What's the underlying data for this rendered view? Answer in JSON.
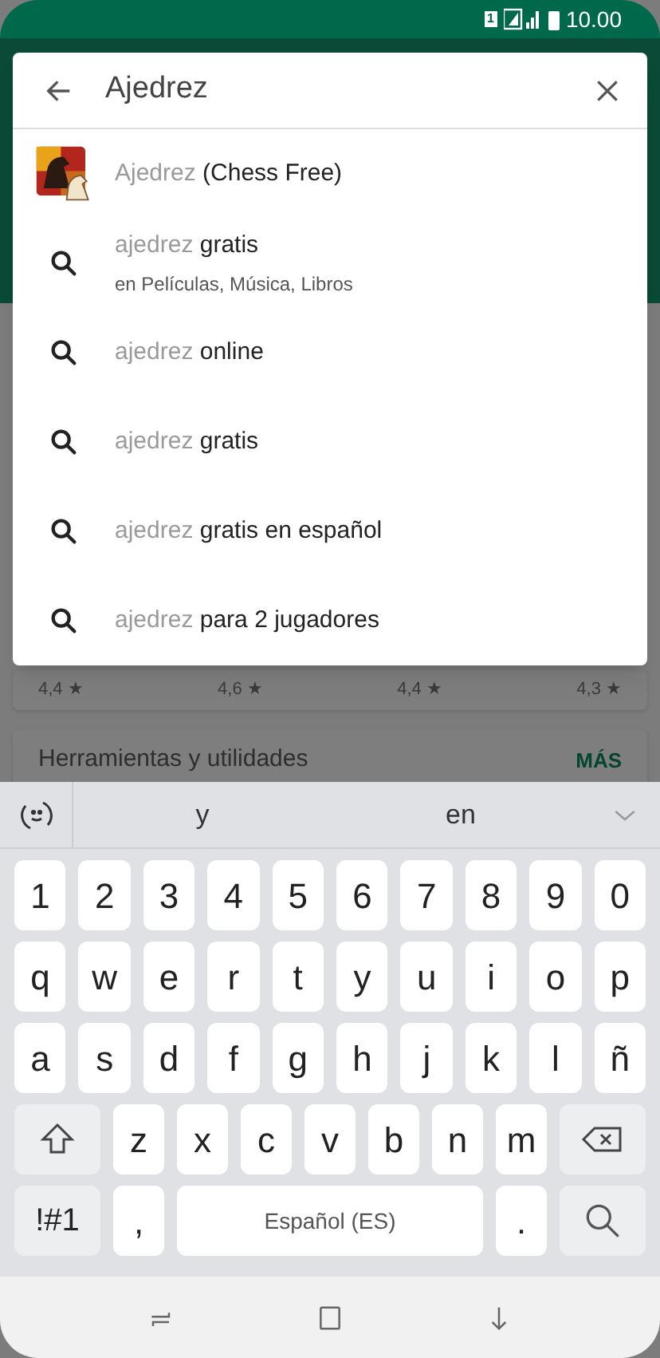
{
  "status_bar": {
    "sim": "1",
    "time": "10.00"
  },
  "search": {
    "value": "Ajedrez"
  },
  "suggestions": [
    {
      "kind": "app",
      "match": "Ajedrez",
      "rest": "(Chess Free)"
    },
    {
      "kind": "query",
      "match": "ajedrez",
      "rest": "gratis",
      "subtitle": "en Películas, Música, Libros"
    },
    {
      "kind": "query",
      "match": "ajedrez",
      "rest": "online"
    },
    {
      "kind": "query",
      "match": "ajedrez",
      "rest": "gratis"
    },
    {
      "kind": "query",
      "match": "ajedrez",
      "rest": "gratis en español"
    },
    {
      "kind": "query",
      "match": "ajedrez",
      "rest": "para 2 jugadores"
    }
  ],
  "background": {
    "ratings": [
      "4,4 ★",
      "4,6 ★",
      "4,4 ★",
      "4,3 ★"
    ],
    "section_title": "Herramientas y utilidades",
    "more_link": "MÁS"
  },
  "keyboard": {
    "predictions": [
      "y",
      "en"
    ],
    "rows": [
      [
        {
          "kind": "char",
          "label": "1"
        },
        {
          "kind": "char",
          "label": "2"
        },
        {
          "kind": "char",
          "label": "3"
        },
        {
          "kind": "char",
          "label": "4"
        },
        {
          "kind": "char",
          "label": "5"
        },
        {
          "kind": "char",
          "label": "6"
        },
        {
          "kind": "char",
          "label": "7"
        },
        {
          "kind": "char",
          "label": "8"
        },
        {
          "kind": "char",
          "label": "9"
        },
        {
          "kind": "char",
          "label": "0"
        }
      ],
      [
        {
          "kind": "char",
          "label": "q"
        },
        {
          "kind": "char",
          "label": "w"
        },
        {
          "kind": "char",
          "label": "e"
        },
        {
          "kind": "char",
          "label": "r"
        },
        {
          "kind": "char",
          "label": "t"
        },
        {
          "kind": "char",
          "label": "y"
        },
        {
          "kind": "char",
          "label": "u"
        },
        {
          "kind": "char",
          "label": "i"
        },
        {
          "kind": "char",
          "label": "o"
        },
        {
          "kind": "char",
          "label": "p"
        }
      ],
      [
        {
          "kind": "char",
          "label": "a"
        },
        {
          "kind": "char",
          "label": "s"
        },
        {
          "kind": "char",
          "label": "d"
        },
        {
          "kind": "char",
          "label": "f"
        },
        {
          "kind": "char",
          "label": "g"
        },
        {
          "kind": "char",
          "label": "h"
        },
        {
          "kind": "char",
          "label": "j"
        },
        {
          "kind": "char",
          "label": "k"
        },
        {
          "kind": "char",
          "label": "l"
        },
        {
          "kind": "char",
          "label": "ñ"
        }
      ],
      [
        {
          "kind": "shift"
        },
        {
          "kind": "char",
          "label": "z"
        },
        {
          "kind": "char",
          "label": "x"
        },
        {
          "kind": "char",
          "label": "c"
        },
        {
          "kind": "char",
          "label": "v"
        },
        {
          "kind": "char",
          "label": "b"
        },
        {
          "kind": "char",
          "label": "n"
        },
        {
          "kind": "char",
          "label": "m"
        },
        {
          "kind": "backspace"
        }
      ]
    ],
    "bottom_row": {
      "symbols_key": "!#1",
      "comma_key": ",",
      "space_key": "Español (ES)",
      "period_key": "."
    }
  }
}
